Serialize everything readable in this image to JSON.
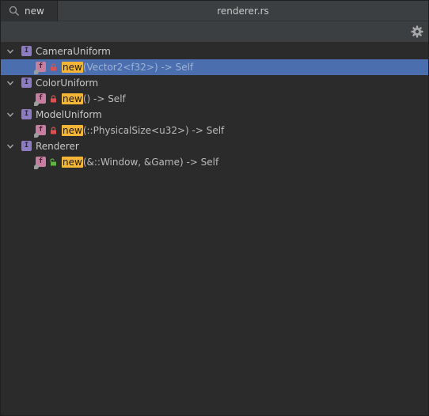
{
  "search": {
    "value": "new",
    "placeholder": ""
  },
  "title": "renderer.rs",
  "toolbar": {
    "settings_icon": "gear-icon"
  },
  "colors": {
    "selection": "#4b6eaf",
    "highlight": "#f5b536",
    "struct_icon": "#8e7cc3",
    "fn_icon": "#c77fa0",
    "lock_private": "#d95252",
    "lock_public": "#62b543"
  },
  "tree": [
    {
      "label": "CameraUniform",
      "expanded": true,
      "children": [
        {
          "match": "new",
          "signature": "(Vector2<f32>) -> Self",
          "visibility": "private",
          "selected": true
        }
      ]
    },
    {
      "label": "ColorUniform",
      "expanded": true,
      "children": [
        {
          "match": "new",
          "signature": "() -> Self",
          "visibility": "private",
          "selected": false
        }
      ]
    },
    {
      "label": "ModelUniform",
      "expanded": true,
      "children": [
        {
          "match": "new",
          "signature": "(::PhysicalSize<u32>) -> Self",
          "visibility": "private",
          "selected": false
        }
      ]
    },
    {
      "label": "Renderer",
      "expanded": true,
      "children": [
        {
          "match": "new",
          "signature": "(&::Window, &Game) -> Self",
          "visibility": "public",
          "selected": false
        }
      ]
    }
  ]
}
